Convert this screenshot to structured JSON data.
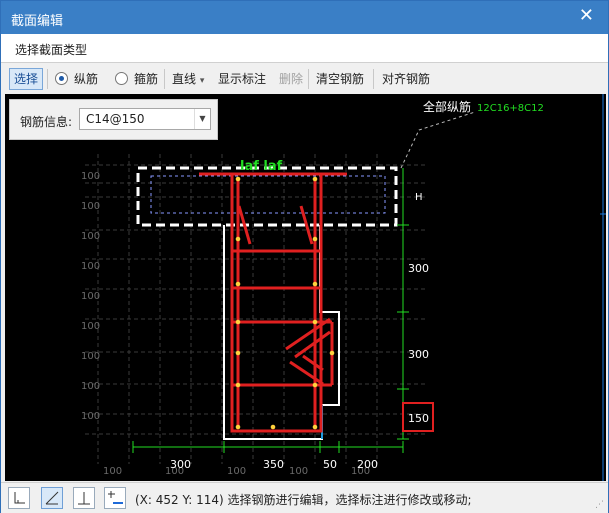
{
  "window": {
    "title": "截面编辑",
    "close_glyph": "✕"
  },
  "type_bar": {
    "label": "选择截面类型"
  },
  "toolbar": {
    "select": "选择",
    "longitudinal": "纵筋",
    "stirrup": "箍筋",
    "line": "直线",
    "line_arrow": "▾",
    "show_labels": "显示标注",
    "delete": "删除",
    "clear": "清空钢筋",
    "align": "对齐钢筋",
    "selected_radio": "纵筋"
  },
  "rebar_info": {
    "label": "钢筋信息:",
    "value": "C14@150"
  },
  "drawing": {
    "all_long_label": "全部纵筋",
    "all_long_value": "12C16+8C12",
    "top_label": "laf  laf",
    "right_h": "H",
    "dim_right": [
      "300",
      "300",
      "150"
    ],
    "dim_bottom": [
      "300",
      "350",
      "50",
      "200"
    ],
    "grid_tick_label": "100"
  },
  "status_bar": {
    "coords": "(X: 452 Y: 114)",
    "message": "选择钢筋进行编辑，选择标注进行修改或移动;"
  },
  "colors": {
    "title_bar": "#3a7fc6",
    "rebar": "#e02020",
    "dim": "#22dd22",
    "outline": "#ffffff",
    "highlight_box": "#e02020"
  }
}
